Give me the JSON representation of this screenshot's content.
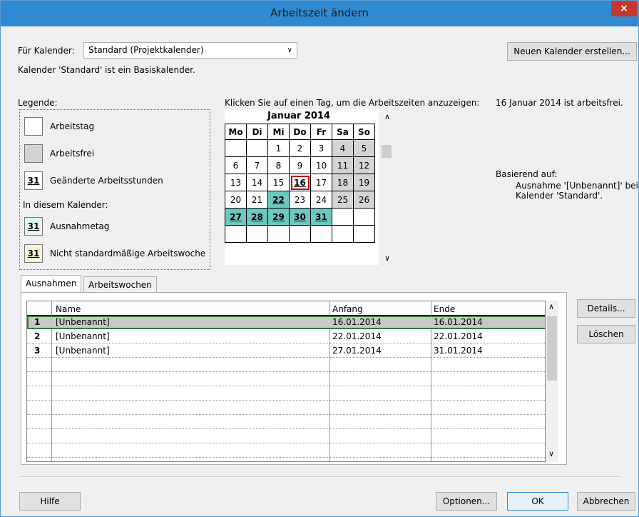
{
  "window": {
    "title": "Arbeitszeit ändern",
    "close_glyph": "×"
  },
  "calendar_select": {
    "label": "Für Kalender:",
    "value": "Standard (Projektkalender)",
    "info": "Kalender 'Standard' ist ein Basiskalender."
  },
  "new_calendar_button": "Neuen Kalender erstellen...",
  "legend": {
    "title": "Legende:",
    "items": [
      {
        "label": "Arbeitstag",
        "glyph": ""
      },
      {
        "label": "Arbeitsfrei",
        "glyph": ""
      },
      {
        "label": "Geänderte Arbeitsstunden",
        "glyph": "31"
      }
    ],
    "in_calendar_title": "In diesem Kalender:",
    "calendar_items": [
      {
        "label": "Ausnahmetag",
        "glyph": "31"
      },
      {
        "label": "Nicht standardmäßige Arbeitswoche",
        "glyph": "31"
      }
    ]
  },
  "calendar": {
    "hint": "Klicken Sie auf einen Tag, um die Arbeitszeiten anzuzeigen:",
    "month": "Januar 2014",
    "weekdays": [
      "Mo",
      "Di",
      "Mi",
      "Do",
      "Fr",
      "Sa",
      "So"
    ],
    "weeks": [
      [
        "",
        "",
        "1",
        "2",
        "3",
        "4",
        "5"
      ],
      [
        "6",
        "7",
        "8",
        "9",
        "10",
        "11",
        "12"
      ],
      [
        "13",
        "14",
        "15",
        "16",
        "17",
        "18",
        "19"
      ],
      [
        "20",
        "21",
        "22",
        "23",
        "24",
        "25",
        "26"
      ],
      [
        "27",
        "28",
        "29",
        "30",
        "31",
        "",
        ""
      ],
      [
        "",
        "",
        "",
        "",
        "",
        "",
        ""
      ]
    ]
  },
  "day_status": "16 Januar 2014 ist arbeitsfrei.",
  "based_on": {
    "title": "Basierend auf:",
    "line1": "Ausnahme '[Unbenannt]' bei",
    "line2": "Kalender 'Standard'."
  },
  "tabs": [
    "Ausnahmen",
    "Arbeitswochen"
  ],
  "grid": {
    "headers": [
      "Name",
      "Anfang",
      "Ende"
    ],
    "rows": [
      {
        "num": "1",
        "name": "[Unbenannt]",
        "start": "16.01.2014",
        "end": "16.01.2014"
      },
      {
        "num": "2",
        "name": "[Unbenannt]",
        "start": "22.01.2014",
        "end": "22.01.2014"
      },
      {
        "num": "3",
        "name": "[Unbenannt]",
        "start": "27.01.2014",
        "end": "31.01.2014"
      }
    ]
  },
  "side_buttons": {
    "details": "Details...",
    "delete": "Löschen"
  },
  "footer": {
    "help": "Hilfe",
    "options": "Optionen...",
    "ok": "OK",
    "cancel": "Abbrechen"
  },
  "colors": {
    "titlebar": "#2f8ad2",
    "nonworking": "#d4d4d4",
    "exception": "#6cc7c0",
    "selected_outline": "#c00000"
  }
}
